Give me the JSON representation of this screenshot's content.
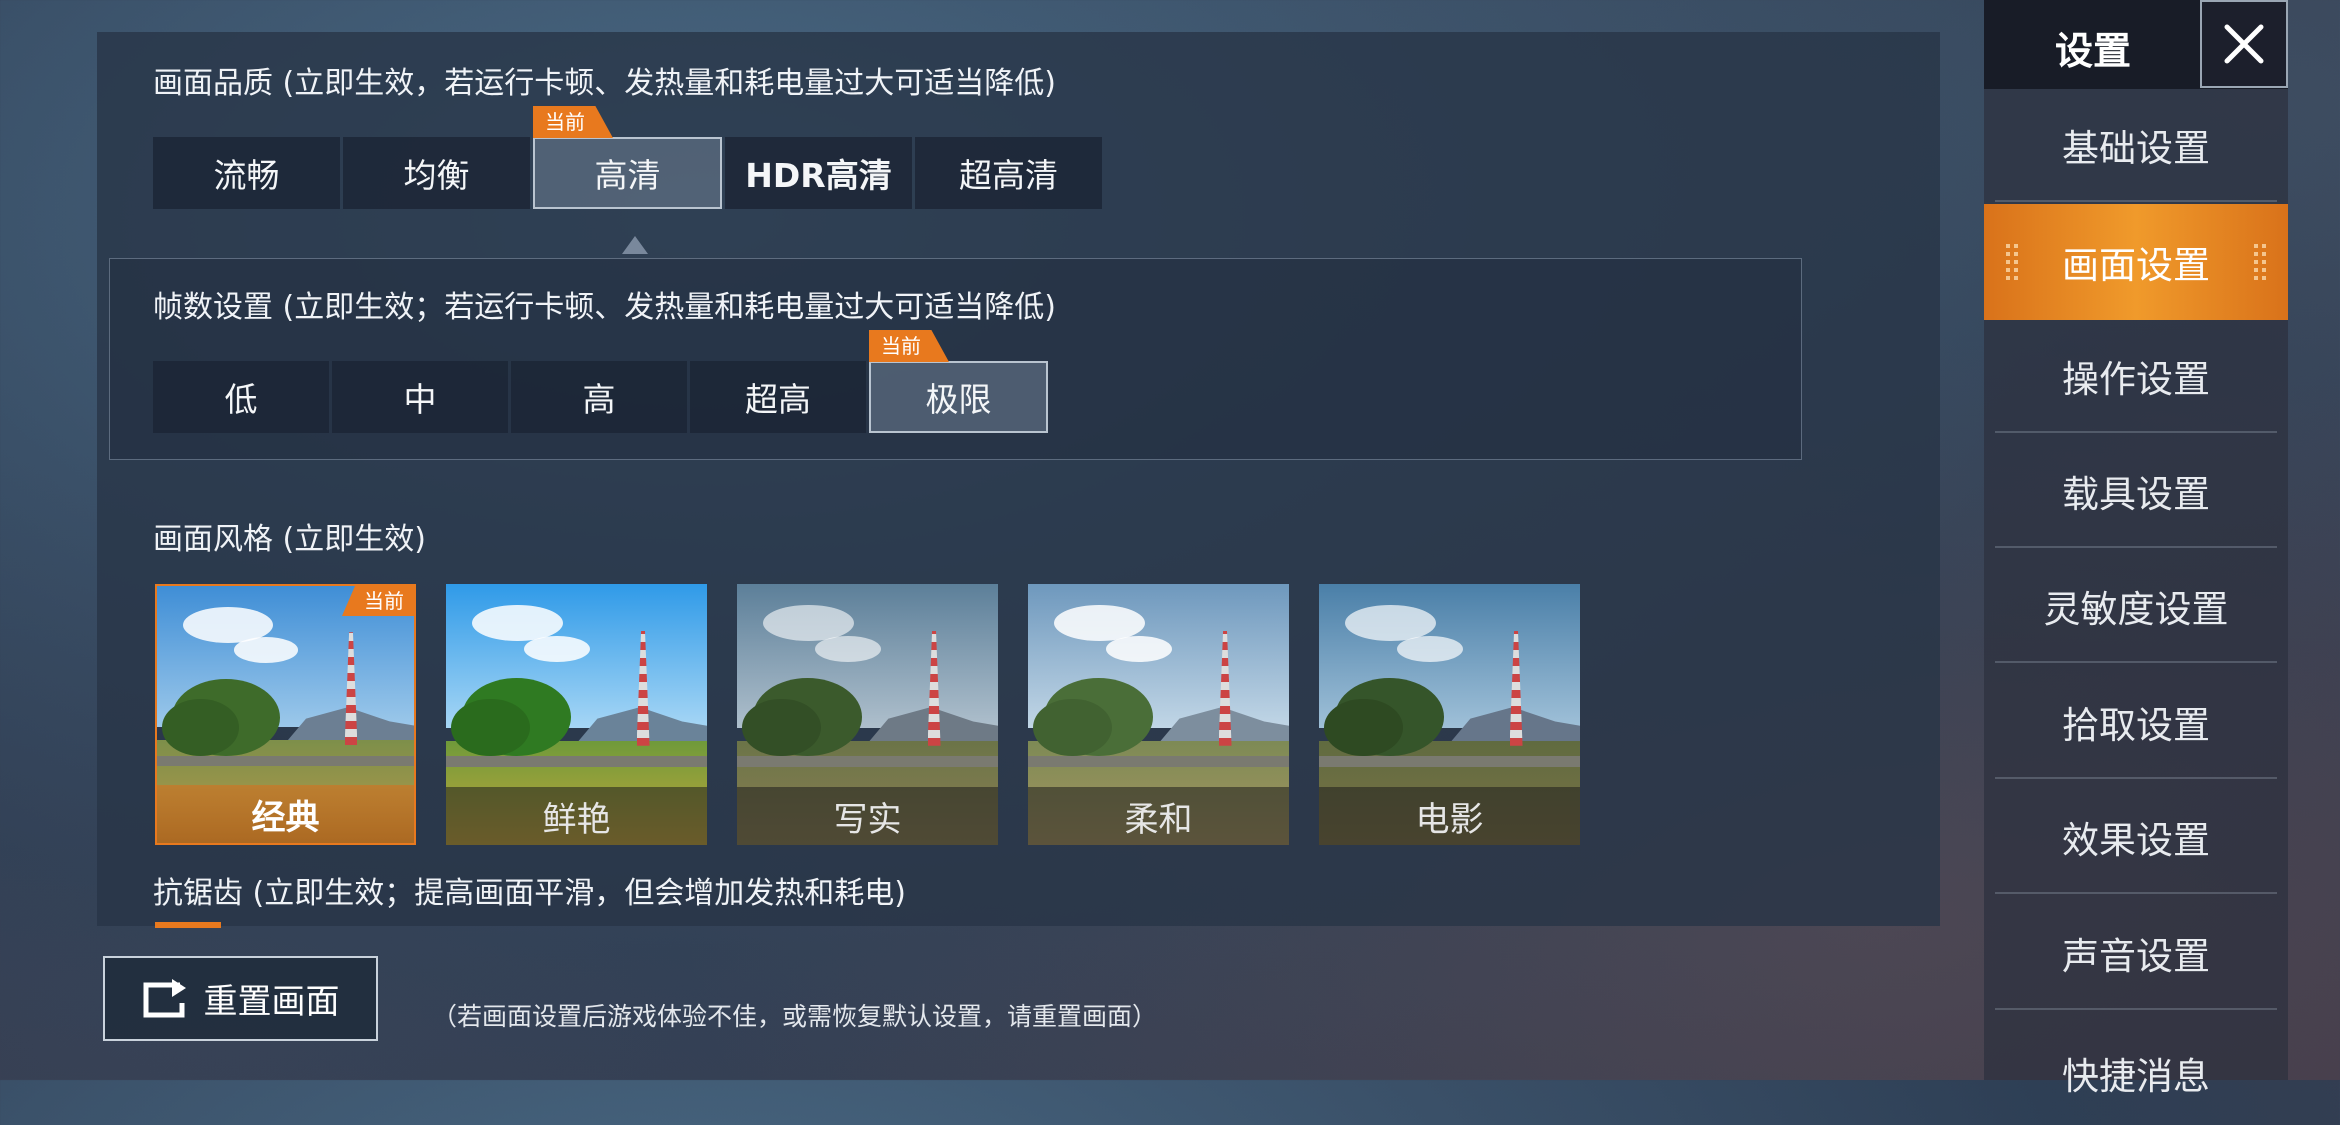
{
  "quality": {
    "title": "画面品质 (立即生效，若运行卡顿、发热量和耗电量过大可适当降低)",
    "options": [
      "流畅",
      "均衡",
      "高清",
      "HDR高清",
      "超高清"
    ],
    "selected_index": 2,
    "current_badge": "当前"
  },
  "fps": {
    "title": "帧数设置 (立即生效；若运行卡顿、发热量和耗电量过大可适当降低)",
    "options": [
      "低",
      "中",
      "高",
      "超高",
      "极限"
    ],
    "selected_index": 4,
    "current_badge": "当前"
  },
  "style": {
    "title": "画面风格 (立即生效)",
    "options": [
      "经典",
      "鲜艳",
      "写实",
      "柔和",
      "电影"
    ],
    "selected_index": 0,
    "current_badge": "当前"
  },
  "antialias": {
    "title": "抗锯齿 (立即生效；提高画面平滑，但会增加发热和耗电)"
  },
  "reset": {
    "button_label": "重置画面",
    "note": "（若画面设置后游戏体验不佳，或需恢复默认设置，请重置画面）"
  },
  "sidebar": {
    "title": "设置",
    "close_icon": "close-icon",
    "items": [
      "基础设置",
      "画面设置",
      "操作设置",
      "载具设置",
      "灵敏度设置",
      "拾取设置",
      "效果设置",
      "声音设置",
      "快捷消息"
    ],
    "active_index": 1
  },
  "colors": {
    "accent": "#e8791e",
    "panel": "#28344a"
  }
}
